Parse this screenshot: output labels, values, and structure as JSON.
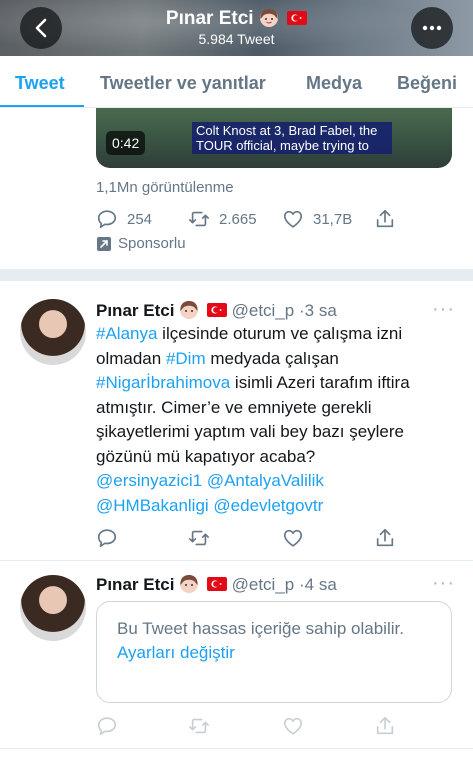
{
  "header": {
    "name": "Pınar Etci",
    "tweet_count": "5.984 Tweet"
  },
  "tabs": [
    {
      "label": "Tweet"
    },
    {
      "label": "Tweetler ve yanıtlar"
    },
    {
      "label": "Medya"
    },
    {
      "label": "Beğeni"
    }
  ],
  "promoted": {
    "video_caption": "Colt Knost at 3, Brad Fabel, the TOUR official, maybe trying to",
    "duration": "0:42",
    "views": "1,1Mn görüntülenme",
    "replies": "254",
    "retweets": "2.665",
    "likes": "31,7B",
    "sponsor_label": "Sponsorlu"
  },
  "tweets": [
    {
      "name": "Pınar Etci",
      "handle": "@etci_p",
      "time": "3 sa",
      "body": {
        "hashtag1": "#Alanya",
        "text1": " ilçesinde oturum ve çalışma izni olmadan ",
        "hashtag2": "#Dim",
        "text2": " medyada çalışan ",
        "hashtag3": "#Nigarİbrahimova",
        "text3": " isimli Azeri tarafım iftira atmıştır. Cimer’e ve emniyete gerekli şikayetlerimi yaptım vali bey bazı şeylere gözünü mü kapatıyor acaba?",
        "mention1": "@ersinyazici1",
        "mention2": "@AntalyaValilik",
        "mention3": "@HMBakanligi",
        "mention4": "@edevletgovtr"
      }
    },
    {
      "name": "Pınar Etci",
      "handle": "@etci_p",
      "time": "4 sa",
      "sensitive_text": "Bu Tweet hassas içeriğe sahip olabilir.",
      "settings_link": "Ayarları değiştir"
    }
  ],
  "colors": {
    "accent": "#1da1f2",
    "muted": "#657786",
    "separator": "#e6ecf0"
  },
  "icons": [
    "back-icon",
    "more-icon",
    "reply-icon",
    "retweet-icon",
    "like-icon",
    "share-icon",
    "promoted-icon",
    "woman-emoji-icon",
    "turkey-flag-icon"
  ]
}
